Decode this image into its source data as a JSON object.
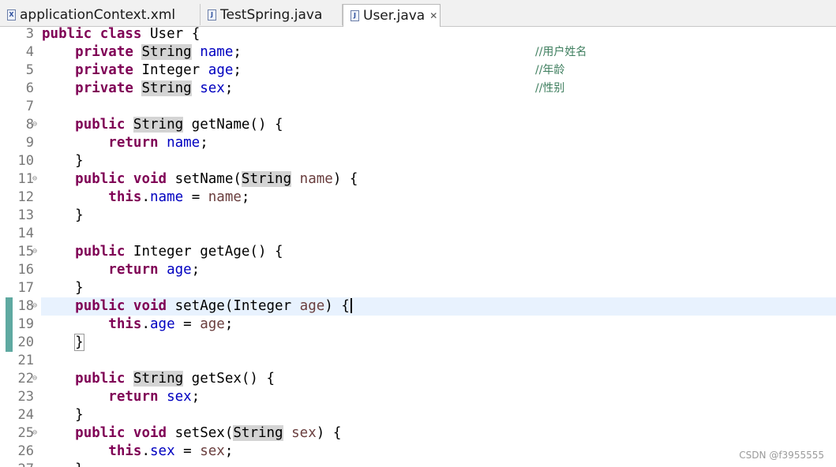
{
  "tabs": [
    {
      "label": "applicationContext.xml",
      "icon": "xml-file-icon",
      "icon_glyph": "X",
      "active": false
    },
    {
      "label": "TestSpring.java",
      "icon": "java-file-icon",
      "icon_glyph": "J",
      "active": false
    },
    {
      "label": "User.java",
      "icon": "java-file-icon",
      "icon_glyph": "J",
      "active": true,
      "close_glyph": "✕"
    }
  ],
  "editor": {
    "lines": [
      {
        "num": "3",
        "html_kind": "class_decl",
        "tokens": {
          "kw1": "public",
          "kw2": "class",
          "name": "User",
          "rest": " {"
        }
      },
      {
        "num": "4",
        "html_kind": "field",
        "tokens": {
          "kw": "private",
          "type": "String",
          "type_highlight": true,
          "field": "name",
          "comment": "//用户姓名"
        }
      },
      {
        "num": "5",
        "html_kind": "field",
        "tokens": {
          "kw": "private",
          "type": "Integer",
          "type_highlight": false,
          "field": "age",
          "comment": "//年龄"
        }
      },
      {
        "num": "6",
        "html_kind": "field",
        "tokens": {
          "kw": "private",
          "type": "String",
          "type_highlight": true,
          "field": "sex",
          "comment": "//性别"
        }
      },
      {
        "num": "7"
      },
      {
        "num": "8",
        "fold": true
      },
      {
        "num": "9"
      },
      {
        "num": "10"
      },
      {
        "num": "11",
        "fold": true
      },
      {
        "num": "12"
      },
      {
        "num": "13"
      },
      {
        "num": "14"
      },
      {
        "num": "15",
        "fold": true
      },
      {
        "num": "16"
      },
      {
        "num": "17"
      },
      {
        "num": "18",
        "fold": true,
        "current": true,
        "changed": true
      },
      {
        "num": "19",
        "changed": true
      },
      {
        "num": "20",
        "changed": true
      },
      {
        "num": "21"
      },
      {
        "num": "22",
        "fold": true
      },
      {
        "num": "23"
      },
      {
        "num": "24"
      },
      {
        "num": "25",
        "fold": true
      },
      {
        "num": "26"
      },
      {
        "num": "27"
      }
    ],
    "text": {
      "l8": {
        "kw": "public",
        "type": "String",
        "rest": " getName() {"
      },
      "l9": {
        "kw": "return",
        "field": "name",
        "rest": ";"
      },
      "l10": "}",
      "l11": {
        "kw1": "public",
        "kw2": "void",
        "mid": " setName(",
        "type": "String",
        "param": "name",
        "rest": ") {"
      },
      "l12": {
        "kw": "this",
        "field": "name",
        "mid": " = ",
        "param": "name",
        "rest": ";"
      },
      "l13": "}",
      "l15": {
        "kw": "public",
        "mid": " Integer getAge() {"
      },
      "l16": {
        "kw": "return",
        "field": "age",
        "rest": ";"
      },
      "l17": "}",
      "l18": {
        "kw1": "public",
        "kw2": "void",
        "mid": " setAge(Integer ",
        "param": "age",
        "rest": ") {"
      },
      "l19": {
        "kw": "this",
        "field": "age",
        "mid": " = ",
        "param": "age",
        "rest": ";"
      },
      "l20": "}",
      "l22": {
        "kw": "public",
        "type": "String",
        "rest": " getSex() {"
      },
      "l23": {
        "kw": "return",
        "field": "sex",
        "rest": ";"
      },
      "l24": "}",
      "l25": {
        "kw1": "public",
        "kw2": "void",
        "mid": " setSex(",
        "type": "String",
        "param": "sex",
        "rest": ") {"
      },
      "l26": {
        "kw": "this",
        "field": "sex",
        "mid": " = ",
        "param": "sex",
        "rest": ";"
      },
      "l27": "}"
    }
  },
  "watermark": "CSDN @f3955555",
  "colors": {
    "keyword": "#7f0055",
    "field": "#0000c0",
    "param": "#6a3e3e",
    "comment": "#3f7f5f",
    "current_line": "#e8f2fe",
    "change_ruler": "#5fa9a1"
  }
}
